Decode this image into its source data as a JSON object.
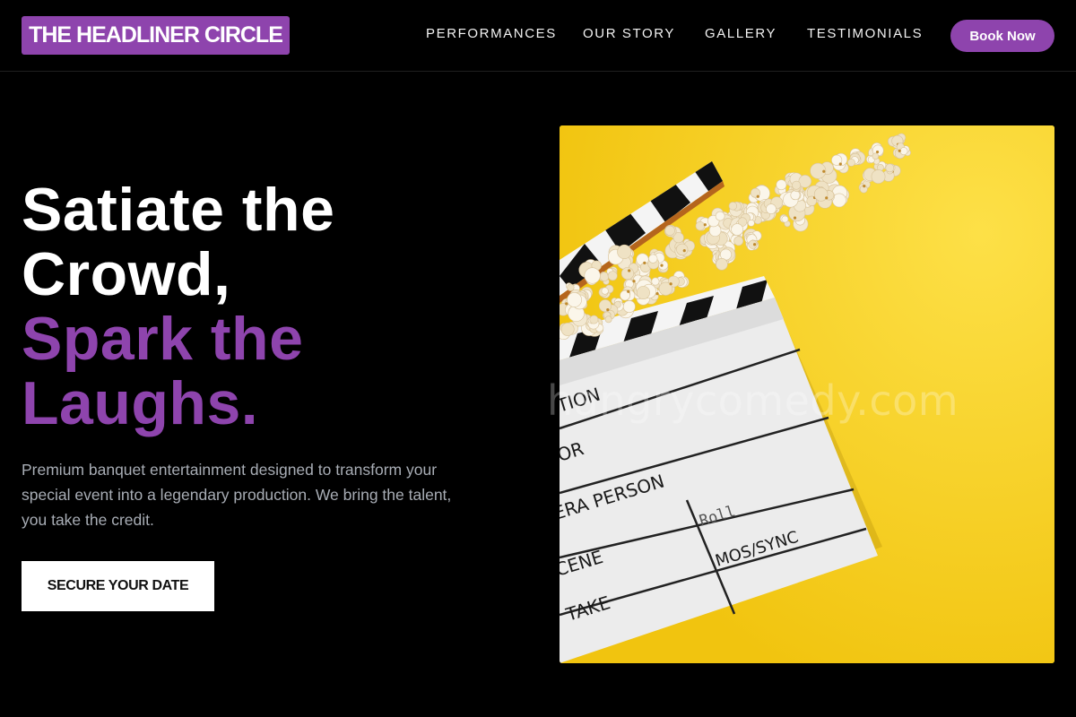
{
  "brand": {
    "logo_text": "THE HEADLINER CIRCLE",
    "accent_color": "#8e44ad"
  },
  "nav": {
    "items": [
      {
        "label": "PERFORMANCES"
      },
      {
        "label": "OUR STORY"
      },
      {
        "label": "GALLERY"
      },
      {
        "label": "TESTIMONIALS"
      }
    ],
    "cta_label": "Book Now"
  },
  "hero": {
    "headline_white": [
      "Satiate the",
      "Crowd,"
    ],
    "headline_purple": [
      "Spark the",
      "Laughs."
    ],
    "description": "Premium banquet entertainment designed to transform your special event into a legendary production. We bring the talent, you take the credit.",
    "cta_label": "SECURE YOUR DATE"
  },
  "image": {
    "slate_labels": [
      "TION",
      "OR",
      "ERA PERSON",
      "CENE",
      "TAKE",
      "Roll",
      "MOS/SYNC"
    ],
    "background_color": "#f5cf12"
  },
  "watermark": "hangrycomedy.com"
}
